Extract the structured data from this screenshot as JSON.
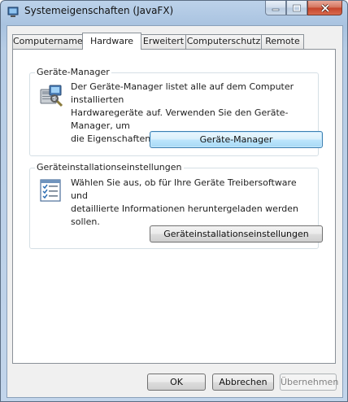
{
  "window": {
    "title": "Systemeigenschaften (JavaFX)"
  },
  "tabs": [
    {
      "label": "Computername"
    },
    {
      "label": "Hardware"
    },
    {
      "label": "Erweitert"
    },
    {
      "label": "Computerschutz"
    },
    {
      "label": "Remote"
    }
  ],
  "active_tab": "Hardware",
  "device_manager": {
    "title": "Geräte-Manager",
    "description_line1": "Der Geräte-Manager listet alle auf dem Computer installierten",
    "description_line2": "Hardwaregeräte auf. Verwenden Sie den Geräte-Manager, um",
    "description_line3": "die Eigenschaften eines Gerätes zu ändern.",
    "button": "Geräte-Manager",
    "icon": "device-manager-icon"
  },
  "device_installation": {
    "title": "Geräteinstallationseinstellungen",
    "description_line1": "Wählen Sie aus, ob für Ihre Geräte Treibersoftware und",
    "description_line2": "detaillierte Informationen heruntergeladen werden sollen.",
    "button": "Geräteinstallationseinstellungen",
    "icon": "checklist-icon"
  },
  "footer": {
    "ok": "OK",
    "cancel": "Abbrechen",
    "apply": "Übernehmen"
  },
  "colors": {
    "frame": "#b6cce5",
    "focus_button": "#bee6fd",
    "close_button": "#c5432a"
  }
}
